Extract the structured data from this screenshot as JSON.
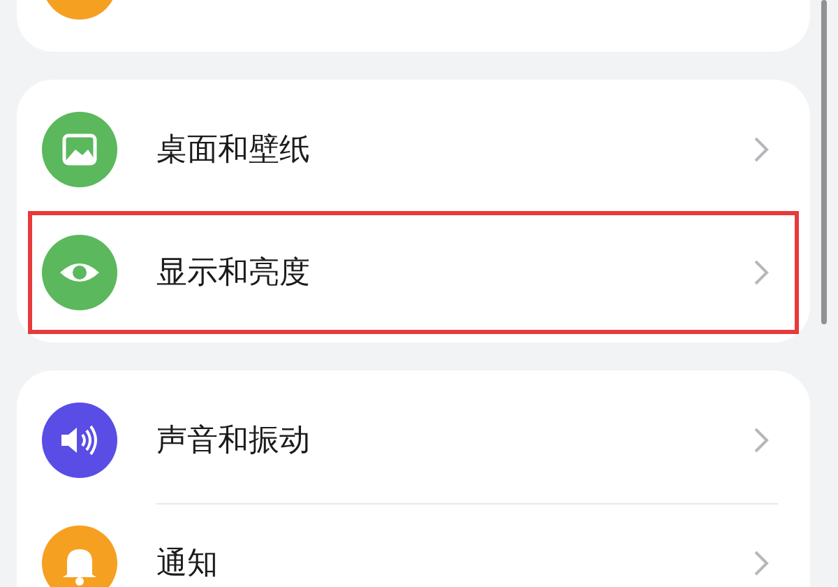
{
  "top_card": {
    "color": "#f6a021"
  },
  "groups": [
    {
      "items": [
        {
          "label": "桌面和壁纸",
          "kind": "picture",
          "color": "#5bb85d",
          "highlighted": false
        },
        {
          "label": "显示和亮度",
          "kind": "eye",
          "color": "#5bb85d",
          "highlighted": true
        }
      ]
    },
    {
      "items": [
        {
          "label": "声音和振动",
          "kind": "speaker",
          "color": "#5a4de6",
          "highlighted": false
        },
        {
          "label": "通知",
          "kind": "bell",
          "color": "#f6a021",
          "highlighted": false
        }
      ]
    }
  ]
}
